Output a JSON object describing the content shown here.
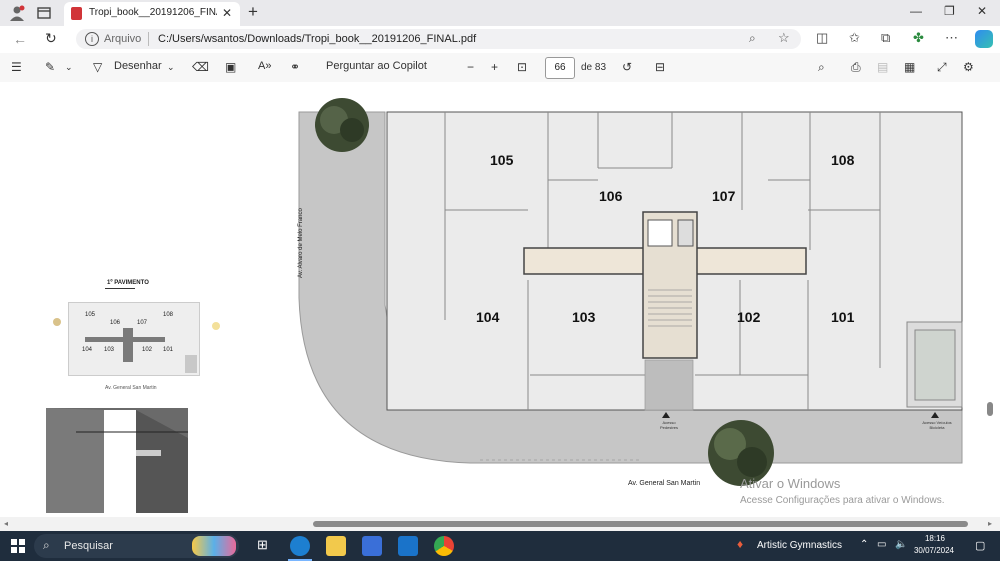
{
  "browser": {
    "tab_title": "Tropi_book__20191206_FINAL.pd",
    "address_scheme": "Arquivo",
    "address_url": "C:/Users/wsantos/Downloads/Tropi_book__20191206_FINAL.pdf"
  },
  "pdf_toolbar": {
    "draw_label": "Desenhar",
    "copilot_label": "Perguntar ao Copilot",
    "page_current": "66",
    "page_total": "de 83"
  },
  "floorplan": {
    "street_left": "Av. Alvaro de Melo Franco",
    "street_bottom": "Av. General San Martin",
    "units": [
      "105",
      "106",
      "107",
      "108",
      "104",
      "103",
      "102",
      "101"
    ],
    "access_left": "Acesso Pedestres",
    "access_right": "Acesso Veículos Bicicleta"
  },
  "minimap": {
    "title": "1º PAVIMENTO",
    "units": [
      "105",
      "106",
      "107",
      "108",
      "104",
      "103",
      "102",
      "101"
    ],
    "street_bottom": "Av. General San Martin"
  },
  "windows_activation": {
    "line1": "Ativar o Windows",
    "line2": "Acesse Configurações para ativar o Windows."
  },
  "taskbar": {
    "search_placeholder": "Pesquisar",
    "news_label": "Artistic Gymnastics",
    "time": "18:16",
    "date": "30/07/2024"
  }
}
